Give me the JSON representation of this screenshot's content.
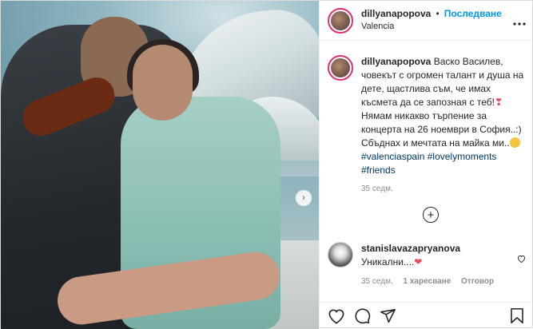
{
  "post": {
    "username": "dillyanapopova",
    "separator": "•",
    "follow_label": "Последване",
    "location": "Valencia",
    "more_icon": "more-horizontal-icon",
    "caption": {
      "username": "dillyanapopova",
      "text_1": " Васко Василев, човекът с огромен талант и душа на дете, щастлива съм, че имах късмета да се запозная с теб!",
      "text_2": " Нямам никакво търпение за концерта на 26 ноември в София..:) Сбъднах и мечтата на майка ми..",
      "tags": [
        "#valenciaspain",
        "#lovelymoments",
        "#friends"
      ],
      "age": "35 седм."
    },
    "comment": {
      "username": "stanislavazapryanova",
      "text": "Уникални....",
      "age": "35 седм.",
      "likes": "1 харесване",
      "reply": "Отговор"
    },
    "colors": {
      "accent": "#0095f6",
      "heart": "#ed4956",
      "text": "#262626",
      "muted": "#8e8e8e"
    }
  }
}
